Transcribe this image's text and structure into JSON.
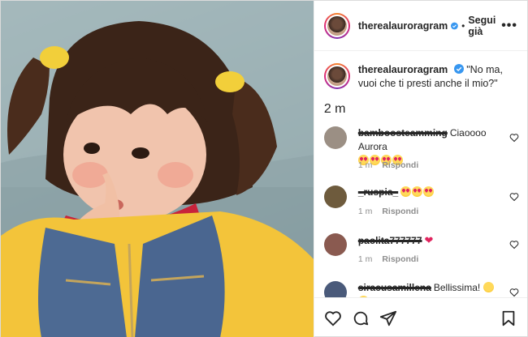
{
  "post": {
    "username": "therealauroragram",
    "separator": "•",
    "follow_label": "Segui già",
    "more_label": "•••",
    "caption": "\"No ma, vuoi che ti presti anche il mio?\"",
    "caption_time": "2 m"
  },
  "comments": [
    {
      "username": "bamboosteamming",
      "text": "Ciaoooo Aurora",
      "emojis": 4,
      "emoji_kind": "heart-eyes",
      "time": "1 m",
      "reply_label": "Rispondi",
      "avatar_color": "#9b8f84"
    },
    {
      "username": "_ruspia_",
      "text": "",
      "emojis": 3,
      "emoji_kind": "heart-eyes",
      "time": "1 m",
      "reply_label": "Rispondi",
      "avatar_color": "#6e5b3d"
    },
    {
      "username": "paolita777777",
      "text": "",
      "emojis": 0,
      "emoji_kind": "red-heart",
      "time": "1 m",
      "reply_label": "Rispondi",
      "avatar_color": "#8a5a50"
    },
    {
      "username": "siracusamillena",
      "text": "Bellissima!",
      "emojis": 2,
      "emoji_kind": "laugh",
      "time": "",
      "reply_label": "",
      "avatar_color": "#4a5a7a"
    }
  ],
  "emoji_glyphs": {
    "red-heart": "❤"
  },
  "icons": {
    "like": "heart-outline-icon",
    "comment": "comment-bubble-icon",
    "share": "paper-plane-icon",
    "save": "bookmark-icon",
    "verified": "verified-badge-icon"
  },
  "colors": {
    "verified": "#3897f0",
    "like_red": "#e0245e",
    "muted": "#8e8e8e"
  }
}
